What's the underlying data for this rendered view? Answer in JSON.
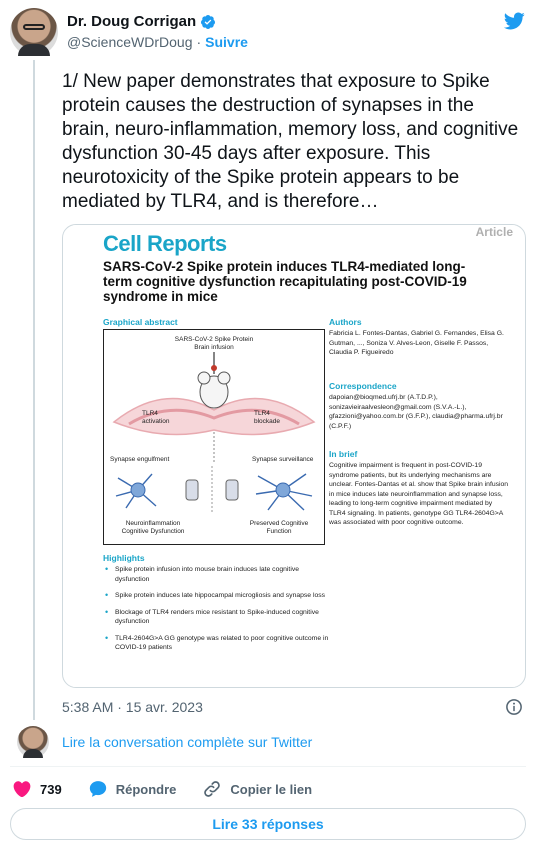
{
  "author": {
    "name": "Dr. Doug Corrigan",
    "handle": "@ScienceWDrDoug",
    "separator": "·",
    "follow_label": "Suivre"
  },
  "tweet": {
    "text": "1/ New paper demonstrates that exposure to Spike protein causes the destruction of synapses in the brain, neuro-inflammation, memory loss, and cognitive dysfunction 30-45 days after exposure. This neurotoxicity of the Spike protein appears to be mediated by TLR4, and is therefore…",
    "timestamp": "5:38 AM · 15 avr. 2023"
  },
  "paper": {
    "journal": "Cell Reports",
    "tag": "Article",
    "title": "SARS-CoV-2 Spike protein induces TLR4-mediated long-term cognitive dysfunction recapitulating post-COVID-19 syndrome in mice",
    "graphical_abstract_label": "Graphical abstract",
    "figure": {
      "top_label": "SARS-CoV-2 Spike Protein",
      "top_sublabel": "Brain infusion",
      "left_label": "TLR4 activation",
      "right_label": "TLR4 blockade",
      "left_process": "Synapse engulfment",
      "right_process": "Synapse surveillance",
      "left_outcome": "Neuroinflammation Cognitive Dysfunction",
      "right_outcome": "Preserved Cognitive Function"
    },
    "authors_label": "Authors",
    "authors": "Fabricia L. Fontes-Dantas, Gabriel G. Fernandes, Elisa G. Gutman, ..., Soniza V. Alves-Leon, Giselle F. Passos, Claudia P. Figueiredo",
    "correspondence_label": "Correspondence",
    "correspondence": "dapoian@bioqmed.ufrj.br (A.T.D.P.), sonizavieiraalvesleon@gmail.com (S.V.A.-L.), gfazzioni@yahoo.com.br (G.F.P.), claudia@pharma.ufrj.br (C.P.F.)",
    "in_brief_label": "In brief",
    "in_brief": "Cognitive impairment is frequent in post-COVID-19 syndrome patients, but its underlying mechanisms are unclear. Fontes-Dantas et al. show that Spike brain infusion in mice induces late neuroinflammation and synapse loss, leading to long-term cognitive impairment mediated by TLR4 signaling. In patients, genotype GG TLR4-2604G>A was associated with poor cognitive outcome.",
    "highlights_label": "Highlights",
    "highlights": [
      "Spike protein infusion into mouse brain induces late cognitive dysfunction",
      "Spike protein induces late hippocampal microgliosis and synapse loss",
      "Blockage of TLR4 renders mice resistant to Spike-induced cognitive dysfunction",
      "TLR4-2604G>A GG genotype was related to poor cognitive outcome in COVID-19 patients"
    ]
  },
  "read_conversation": "Lire la conversation complète sur Twitter",
  "actions": {
    "like_count": "739",
    "reply_label": "Répondre",
    "copy_link_label": "Copier le lien"
  },
  "read_replies": "Lire 33 réponses",
  "colors": {
    "accent": "#1d9bf0",
    "like": "#f91880",
    "journal": "#1aa5c8"
  },
  "icons": [
    "verified-badge-icon",
    "twitter-bird-icon",
    "info-icon",
    "heart-icon",
    "reply-bubble-icon",
    "link-icon"
  ]
}
